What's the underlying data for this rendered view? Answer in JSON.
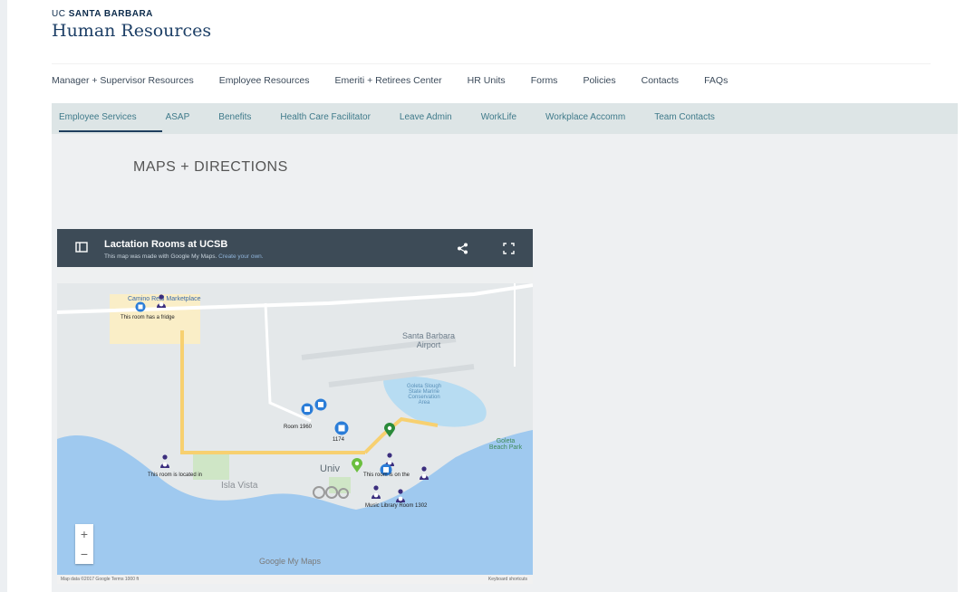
{
  "brand": {
    "uc": "UC",
    "campus": "SANTA BARBARA",
    "title": "Human Resources"
  },
  "nav_primary": [
    {
      "label": "Manager + Supervisor Resources"
    },
    {
      "label": "Employee Resources"
    },
    {
      "label": "Emeriti + Retirees Center"
    },
    {
      "label": "HR Units"
    },
    {
      "label": "Forms"
    },
    {
      "label": "Policies"
    },
    {
      "label": "Contacts"
    },
    {
      "label": "FAQs"
    }
  ],
  "nav_secondary": [
    {
      "label": "Employee Services",
      "active": true
    },
    {
      "label": "ASAP"
    },
    {
      "label": "Benefits"
    },
    {
      "label": "Health Care Facilitator"
    },
    {
      "label": "Leave Admin"
    },
    {
      "label": "WorkLife"
    },
    {
      "label": "Workplace Accomm"
    },
    {
      "label": "Team Contacts"
    }
  ],
  "page": {
    "title": "MAPS + DIRECTIONS"
  },
  "map": {
    "title": "Lactation Rooms at UCSB",
    "subtitle": "This map was made with Google My Maps.",
    "subtitle_link": "Create your own.",
    "places": {
      "airport": "Santa Barbara\nAirport",
      "slough": "Goleta Slough\nState Marine\nConservation\nArea",
      "isla_vista": "Isla Vista",
      "univ": "Univ",
      "goleta_beach": "Goleta\nBeach Park",
      "marketplace": "Camino Real Marketplace"
    },
    "pin_labels": {
      "marketplace_room": "This room has a fridge",
      "iv_room": "This room is located in",
      "room_1960": "Room 1960",
      "room_1174": "1174",
      "library": "Music Library Room 1302",
      "ucen": "This room is on the"
    },
    "zoom_in": "+",
    "zoom_out": "−",
    "footer_left": "Map data ©2017 Google   Terms   1000 ft",
    "footer_right": "Keyboard shortcuts",
    "google_mark": "Google My Maps",
    "colors": {
      "header": "#3d4b57",
      "water": "#9fc9ef",
      "land": "#e4e8ea",
      "road_major": "#f7d070",
      "pin_blue": "#2b7dd8",
      "pin_purple": "#3b2e7e",
      "pin_green": "#2a8a3a"
    }
  }
}
